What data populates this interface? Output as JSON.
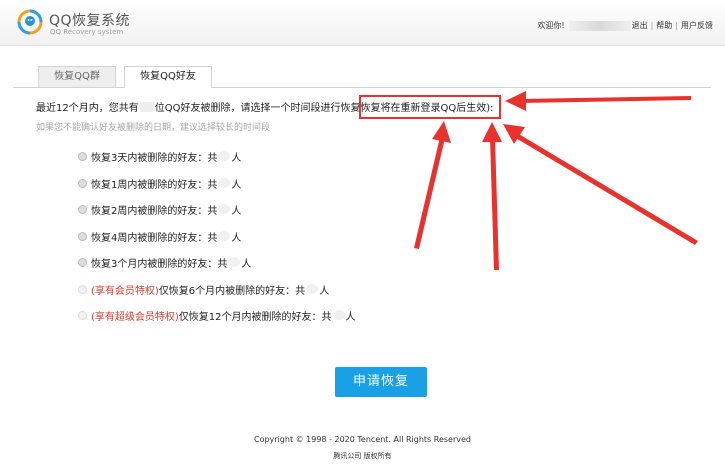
{
  "header": {
    "title": "QQ恢复系统",
    "subtitle": "QQ Recovery system",
    "welcome": "欢迎你!",
    "logout": "退出",
    "help": "帮助",
    "feedback": "用户反馈",
    "sep": "|"
  },
  "tabs": [
    {
      "label": "恢复QQ群",
      "active": false
    },
    {
      "label": "恢复QQ好友",
      "active": true
    }
  ],
  "intro": {
    "part1": "最近12个月内，您共有",
    "part2": "位QQ好友被删除，请选择一个时间段进行恢复",
    "highlight": "恢复将在重新登录QQ后生效):"
  },
  "hint": "如果您不能确认好友被删除的日期，建议选择较长的时间段",
  "options": [
    {
      "tag": "",
      "label": "恢复3天内被删除的好友：共",
      "suffix": "人"
    },
    {
      "tag": "",
      "label": "恢复1周内被删除的好友：共",
      "suffix": "人"
    },
    {
      "tag": "",
      "label": "恢复2周内被删除的好友：共",
      "suffix": "人"
    },
    {
      "tag": "",
      "label": "恢复4周内被删除的好友：共",
      "suffix": "人"
    },
    {
      "tag": "",
      "label": "恢复3个月内被删除的好友：共",
      "suffix": "人"
    },
    {
      "tag": "(享有会员特权)",
      "label": "仅恢复6个月内被删除的好友：共",
      "suffix": "人"
    },
    {
      "tag": "(享有超级会员特权)",
      "label": "仅恢复12个月内被删除的好友：共",
      "suffix": "人"
    }
  ],
  "apply_button": "申请恢复",
  "footer": {
    "copyright": "Copyright © 1998 - 2020 Tencent. All Rights Reserved",
    "company": "腾讯公司 版权所有"
  },
  "colors": {
    "accent": "#1aa0e4",
    "annotation": "#e8322e",
    "tag": "#e0392b"
  }
}
